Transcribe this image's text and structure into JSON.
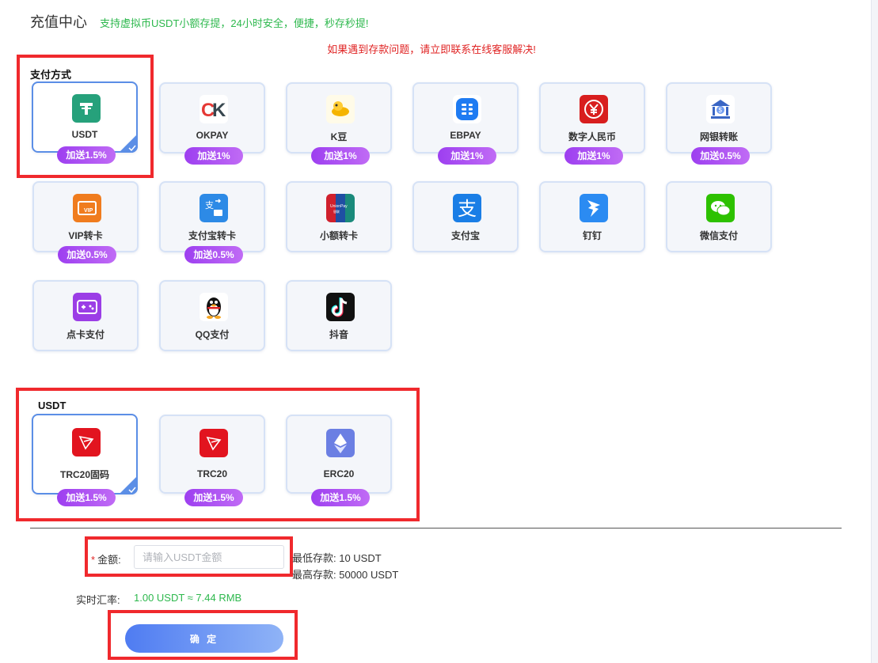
{
  "header": {
    "title": "充值中心",
    "subtitle": "支持虚拟币USDT小额存提，24小时安全，便捷，秒存秒提!"
  },
  "notice": "如果遇到存款问题，请立即联系在线客服解决!",
  "payment_section": {
    "label": "支付方式",
    "methods": [
      {
        "label": "USDT",
        "bonus": "加送1.5%",
        "icon": "usdt-tether-icon",
        "selected": true
      },
      {
        "label": "OKPAY",
        "bonus": "加送1%",
        "icon": "okpay-icon"
      },
      {
        "label": "K豆",
        "bonus": "加送1%",
        "icon": "kdou-icon"
      },
      {
        "label": "EBPAY",
        "bonus": "加送1%",
        "icon": "ebpay-icon"
      },
      {
        "label": "数字人民币",
        "bonus": "加送1%",
        "icon": "digital-rmb-icon"
      },
      {
        "label": "网银转账",
        "bonus": "加送0.5%",
        "icon": "bank-transfer-icon"
      },
      {
        "label": "VIP转卡",
        "bonus": "加送0.5%",
        "icon": "vip-card-icon"
      },
      {
        "label": "支付宝转卡",
        "bonus": "加送0.5%",
        "icon": "alipay-card-transfer-icon"
      },
      {
        "label": "小额转卡",
        "icon": "unionpay-icon"
      },
      {
        "label": "支付宝",
        "icon": "alipay-icon"
      },
      {
        "label": "钉钉",
        "icon": "dingtalk-icon"
      },
      {
        "label": "微信支付",
        "icon": "wechat-pay-icon"
      },
      {
        "label": "点卡支付",
        "icon": "game-card-icon"
      },
      {
        "label": "QQ支付",
        "icon": "qq-penguin-icon"
      },
      {
        "label": "抖音",
        "icon": "douyin-icon"
      }
    ]
  },
  "usdt_section": {
    "label": "USDT",
    "channels": [
      {
        "label": "TRC20固码",
        "bonus": "加送1.5%",
        "icon": "tron-icon",
        "selected": true
      },
      {
        "label": "TRC20",
        "bonus": "加送1.5%",
        "icon": "tron-icon"
      },
      {
        "label": "ERC20",
        "bonus": "加送1.5%",
        "icon": "ethereum-icon"
      }
    ]
  },
  "form": {
    "amount_required_mark": "*",
    "amount_label": "金额:",
    "amount_placeholder": "请输入USDT金额",
    "amount_value": "",
    "min_deposit": "最低存款: 10 USDT",
    "max_deposit": "最高存款: 50000 USDT",
    "rate_label": "实时汇率:",
    "rate_value": "1.00 USDT ≈ 7.44 RMB",
    "confirm_label": "确 定"
  },
  "colors": {
    "accent_blue": "#5b8ee6",
    "bonus_purple": "#a347f2",
    "highlight_red": "#f0292d",
    "success_green": "#2db84d",
    "notice_red": "#e02424"
  }
}
